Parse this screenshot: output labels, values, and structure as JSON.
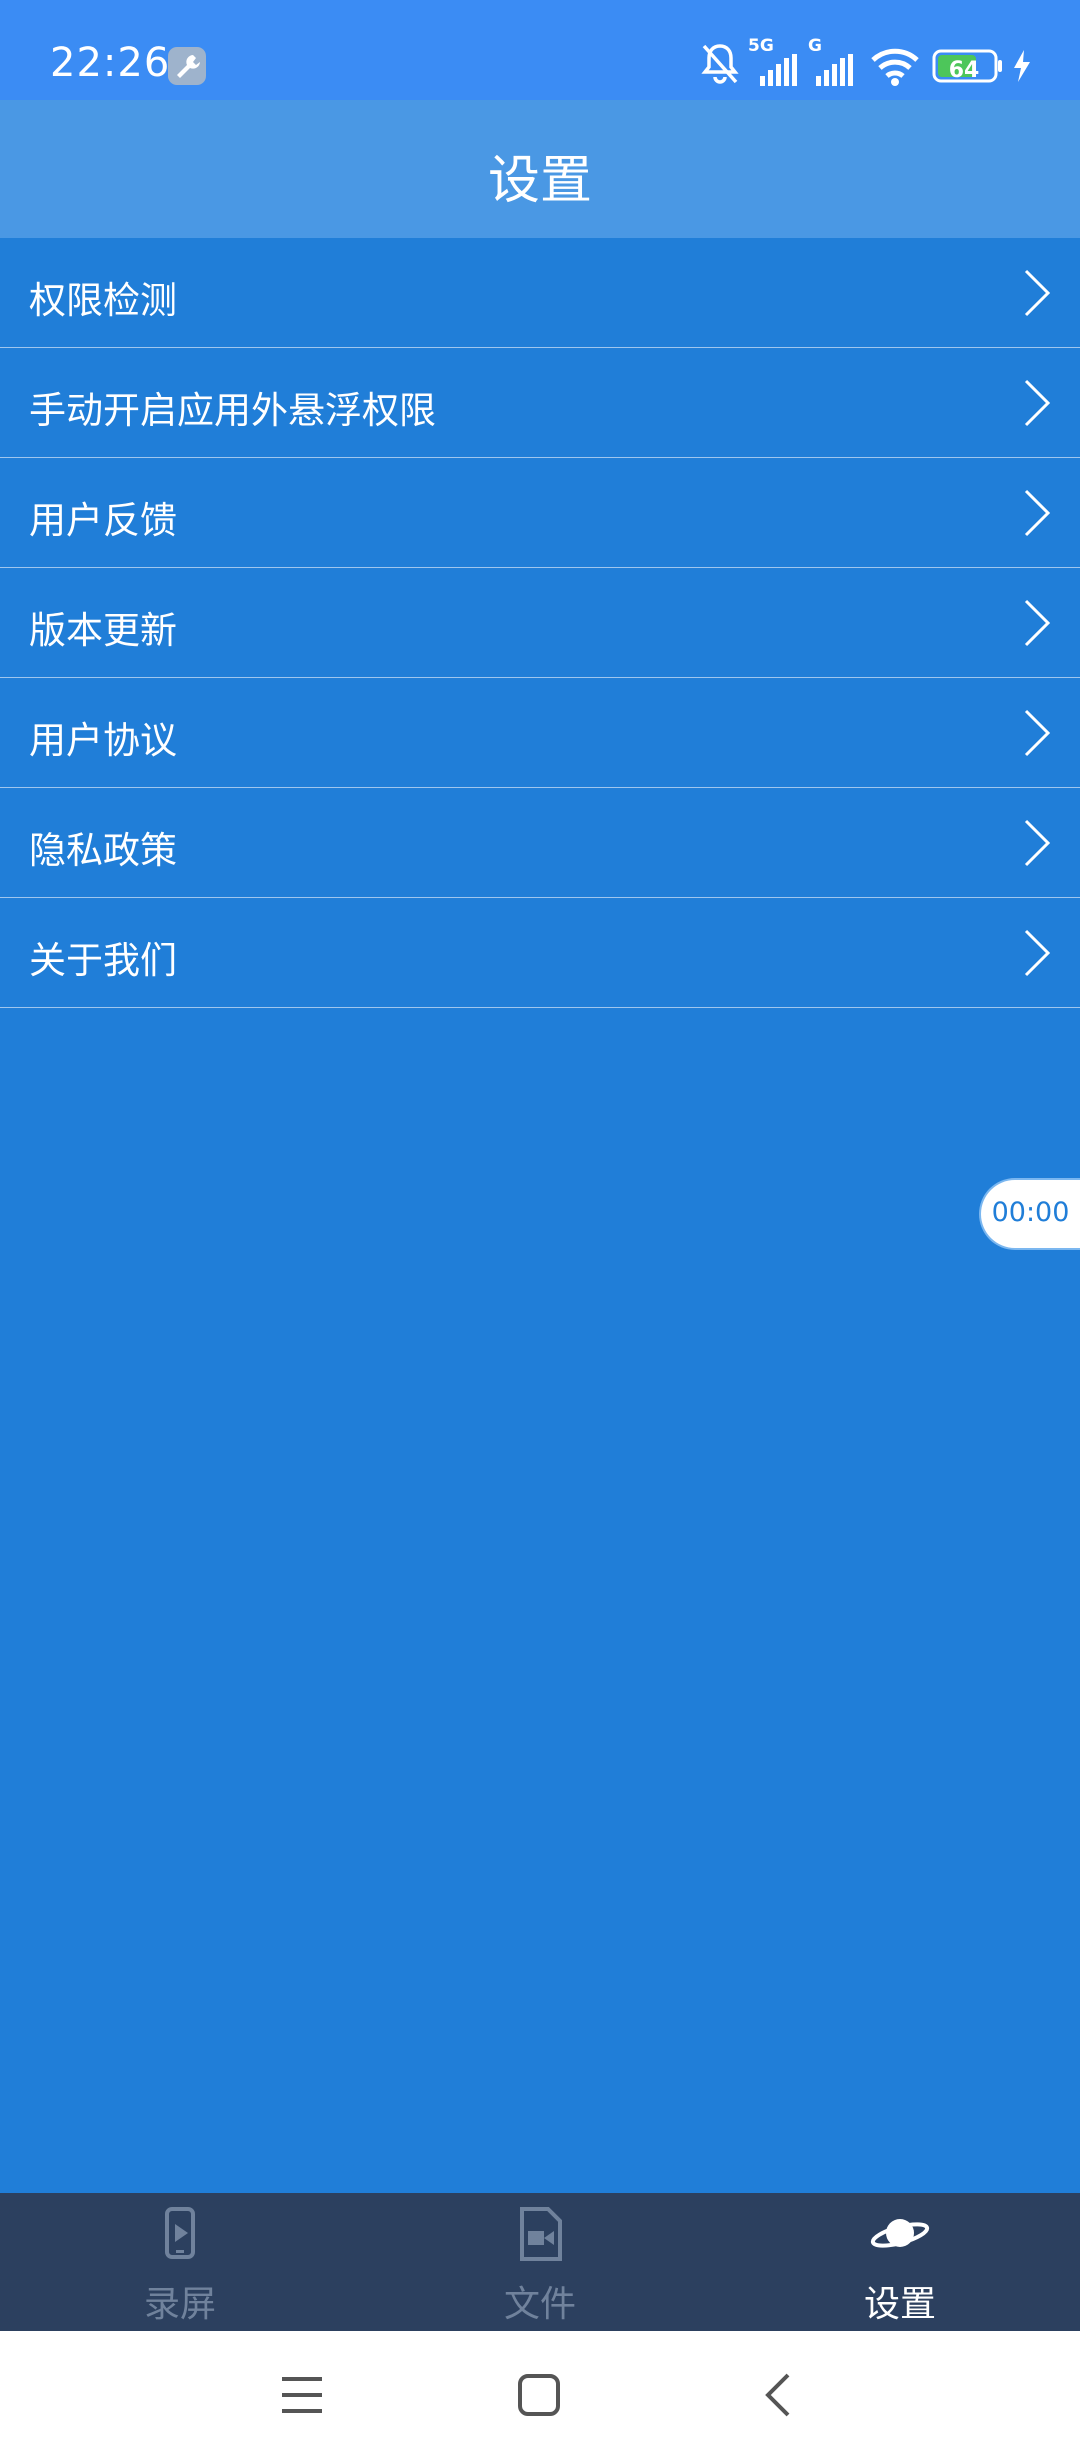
{
  "status_bar": {
    "time": "22:26",
    "network_1": "5G",
    "network_2": "G",
    "battery": "64"
  },
  "header": {
    "title": "设置"
  },
  "settings": {
    "items": [
      {
        "label": "权限检测"
      },
      {
        "label": "手动开启应用外悬浮权限"
      },
      {
        "label": "用户反馈"
      },
      {
        "label": "版本更新"
      },
      {
        "label": "用户协议"
      },
      {
        "label": "隐私政策"
      },
      {
        "label": "关于我们"
      }
    ]
  },
  "floating_timer": {
    "time": "00:00"
  },
  "bottom_nav": {
    "tabs": [
      {
        "label": "录屏",
        "icon": "phone-record-icon"
      },
      {
        "label": "文件",
        "icon": "video-file-icon"
      },
      {
        "label": "设置",
        "icon": "planet-icon",
        "active": true
      }
    ]
  },
  "colors": {
    "primary": "#207ED8",
    "header": "#4A98E4",
    "status_bar": "#3B8CF4",
    "bottom_nav": "#2C405F",
    "nav_inactive": "#70829C"
  }
}
